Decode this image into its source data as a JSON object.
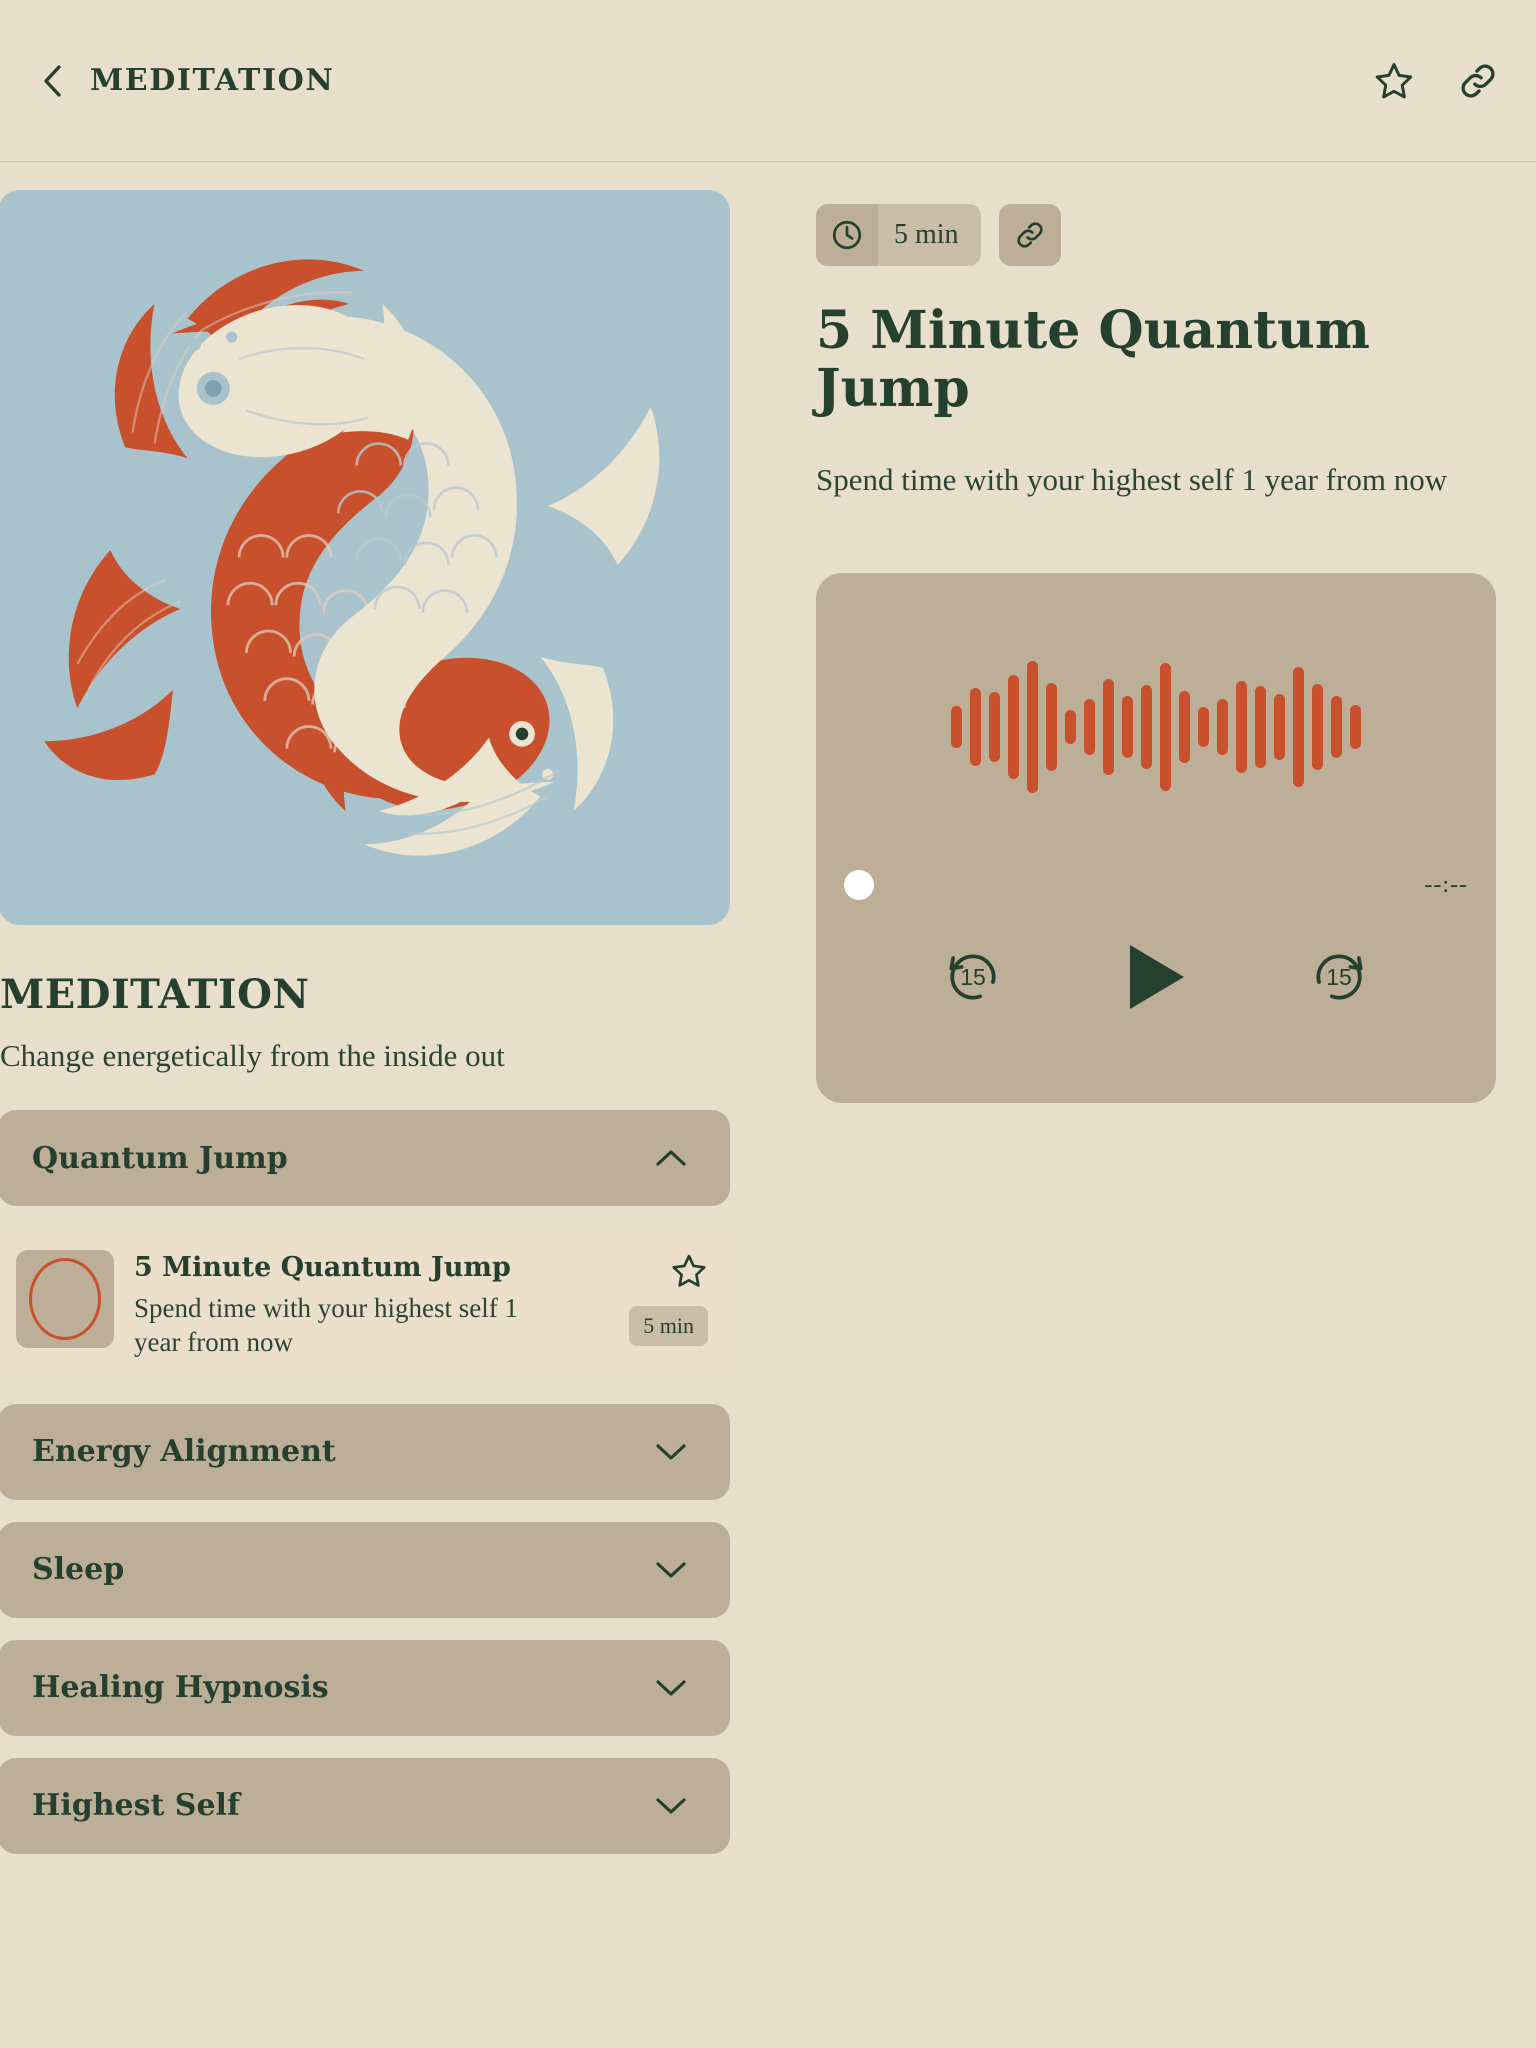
{
  "header": {
    "title": "MEDITATION",
    "back_icon": "chevron-left-icon",
    "favorite_icon": "star-outline-icon",
    "share_icon": "link-icon"
  },
  "hero": {
    "illustration": "koi-fish-yin-yang-illustration",
    "background_color": "#a9c3cc",
    "fish_red_color": "#c8502c",
    "fish_cream_color": "#ebe4d0"
  },
  "sidebar": {
    "heading": "MEDITATION",
    "subtitle": "Change energetically from the inside out",
    "sections": [
      {
        "label": "Quantum Jump",
        "expanded": true,
        "chevron": "chevron-up-icon",
        "tracks": [
          {
            "title": "5 Minute Quantum Jump",
            "description": "Spend time with your highest self 1 year from now",
            "duration": "5 min",
            "favorite_icon": "star-outline-icon",
            "thumbnail": "circle-outline-thumbnail"
          }
        ]
      },
      {
        "label": "Energy Alignment",
        "expanded": false,
        "chevron": "chevron-down-icon",
        "tracks": []
      },
      {
        "label": "Sleep",
        "expanded": false,
        "chevron": "chevron-down-icon",
        "tracks": []
      },
      {
        "label": "Healing Hypnosis",
        "expanded": false,
        "chevron": "chevron-down-icon",
        "tracks": []
      },
      {
        "label": "Highest Self",
        "expanded": false,
        "chevron": "chevron-down-icon",
        "tracks": []
      }
    ]
  },
  "detail": {
    "duration_badge": "5 min",
    "duration_icon": "clock-icon",
    "share_icon": "link-icon",
    "title": "5 Minute Quantum Jump",
    "description": "Spend time with your highest self 1 year from now"
  },
  "player": {
    "time_display": "--:--",
    "rewind_label": "15",
    "forward_label": "15",
    "rewind_icon": "rewind-15-icon",
    "play_icon": "play-icon",
    "forward_icon": "forward-15-icon",
    "progress_percent": 0,
    "waveform_color": "#c8502c",
    "panel_color": "#bdae97",
    "waveform": [
      42,
      78,
      70,
      104,
      132,
      88,
      34,
      56,
      96,
      62,
      84,
      128,
      72,
      40,
      56,
      92,
      82,
      66,
      120,
      86,
      62,
      44
    ]
  },
  "theme": {
    "page_background": "#e7dfcc",
    "accent_green": "#26402f",
    "card_tan": "#bcae97",
    "accent_rust": "#c8502c"
  }
}
